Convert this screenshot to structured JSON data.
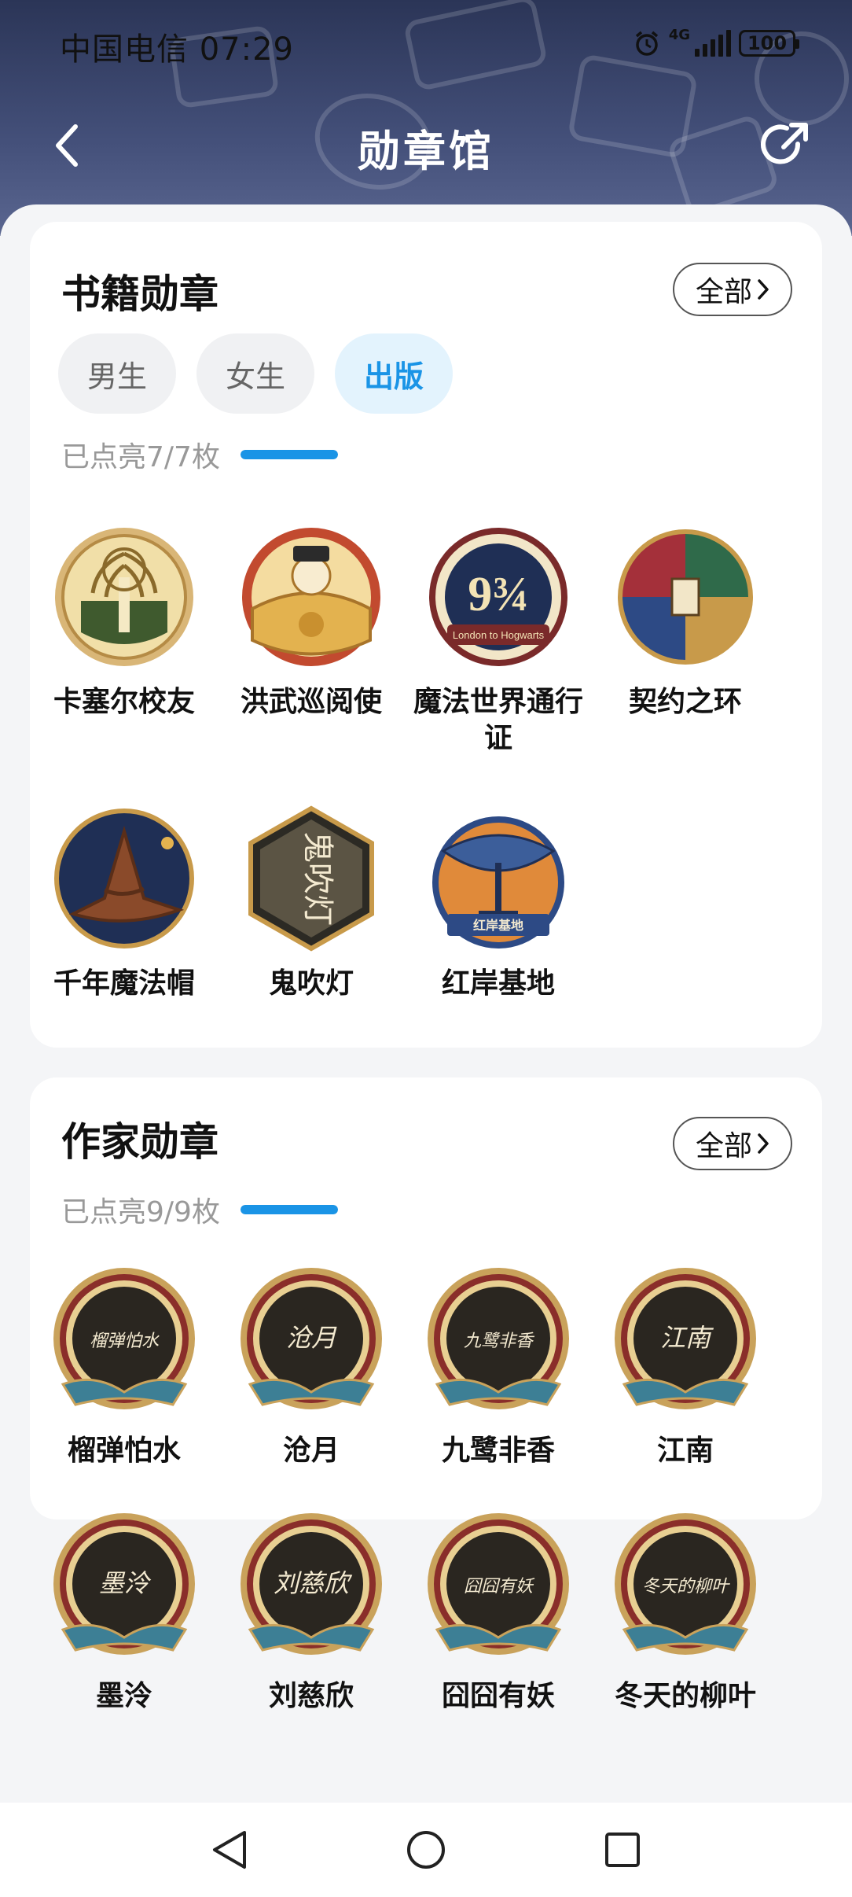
{
  "status_bar": {
    "carrier_time": "中国电信 07:29",
    "network": "4G",
    "battery": "100"
  },
  "nav": {
    "title": "勋章馆",
    "back_icon": "chevron-left-icon",
    "share_icon": "share-icon"
  },
  "book_section": {
    "title": "书籍勋章",
    "all_label": "全部",
    "tabs": [
      {
        "label": "男生",
        "active": false
      },
      {
        "label": "女生",
        "active": false
      },
      {
        "label": "出版",
        "active": true
      }
    ],
    "progress_text": "已点亮7/7枚",
    "progress_fraction": 1.0,
    "badges": [
      {
        "label": "卡塞尔校友"
      },
      {
        "label": "洪武巡阅使"
      },
      {
        "label": "魔法世界通行证",
        "emblem_text": "9¾",
        "emblem_subtext": "London to Hogwarts"
      },
      {
        "label": "契约之环"
      },
      {
        "label": "千年魔法帽"
      },
      {
        "label": "鬼吹灯",
        "emblem_text": "鬼吹灯"
      },
      {
        "label": "红岸基地",
        "emblem_text": "红岸基地"
      }
    ]
  },
  "author_section": {
    "title": "作家勋章",
    "all_label": "全部",
    "progress_text": "已点亮9/9枚",
    "progress_fraction": 1.0,
    "badges": [
      {
        "label": "榴弹怕水",
        "signature": "榴弹怕水"
      },
      {
        "label": "沧月",
        "signature": "沧月"
      },
      {
        "label": "九鹭非香",
        "signature": "九鹭非香"
      },
      {
        "label": "江南",
        "signature": "江南"
      },
      {
        "label": "墨泠",
        "signature": "墨泠"
      },
      {
        "label": "刘慈欣",
        "signature": "刘慈欣"
      },
      {
        "label": "囧囧有妖",
        "signature": "囧囧有妖"
      },
      {
        "label": "冬天的柳叶",
        "signature": "冬天的柳叶"
      }
    ]
  },
  "colors": {
    "accent": "#1a94e6",
    "header": "#2b3557",
    "gold": "#c9a25b"
  },
  "bottom_nav": {
    "back_icon": "triangle-back-icon",
    "home_icon": "circle-home-icon",
    "recents_icon": "square-recents-icon"
  }
}
